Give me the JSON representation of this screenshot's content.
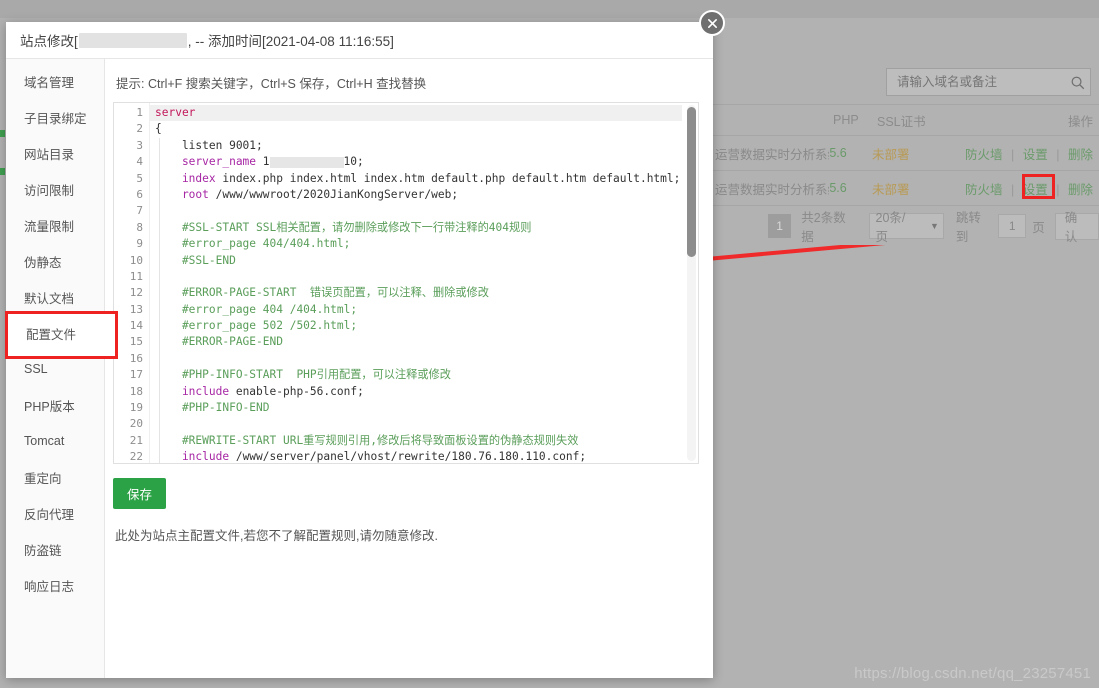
{
  "background": {
    "search": {
      "placeholder": "请输入域名或备注",
      "icon": "search-icon"
    },
    "table": {
      "headers": {
        "php": "PHP",
        "ssl": "SSL证书",
        "ops": "操作"
      },
      "rows": [
        {
          "name": "运营数据实时分析系统",
          "php": "5.6",
          "ssl": "未部署",
          "op_firewall": "防火墙",
          "op_settings": "设置",
          "op_delete": "删除"
        },
        {
          "name": "运营数据实时分析系统",
          "php": "5.6",
          "ssl": "未部署",
          "op_firewall": "防火墙",
          "op_settings": "设置",
          "op_delete": "删除"
        }
      ]
    },
    "pager": {
      "current_page": "1",
      "total_text": "共2条数据",
      "page_size": "20条/页",
      "jump_label": "跳转到",
      "jump_value": "1",
      "page_unit": "页",
      "confirm": "确认"
    }
  },
  "dialog": {
    "title_prefix": "站点修改[",
    "title_suffix": ", -- 添加时间[2021-04-08 11:16:55]",
    "close_icon": "close-icon",
    "sidebar": [
      {
        "label": "域名管理",
        "active": false
      },
      {
        "label": "子目录绑定",
        "active": false
      },
      {
        "label": "网站目录",
        "active": false
      },
      {
        "label": "访问限制",
        "active": false
      },
      {
        "label": "流量限制",
        "active": false
      },
      {
        "label": "伪静态",
        "active": false
      },
      {
        "label": "默认文档",
        "active": false
      },
      {
        "label": "配置文件",
        "active": true
      },
      {
        "label": "SSL",
        "active": false
      },
      {
        "label": "PHP版本",
        "active": false
      },
      {
        "label": "Tomcat",
        "active": false
      },
      {
        "label": "重定向",
        "active": false
      },
      {
        "label": "反向代理",
        "active": false
      },
      {
        "label": "防盗链",
        "active": false
      },
      {
        "label": "响应日志",
        "active": false
      }
    ],
    "hint": "提示: Ctrl+F 搜索关键字，Ctrl+S 保存，Ctrl+H 查找替换",
    "editor": {
      "lines": [
        {
          "n": "1",
          "text": "server"
        },
        {
          "n": "2",
          "text": "{"
        },
        {
          "n": "3",
          "text": "    listen 9001;"
        },
        {
          "n": "4",
          "text": "    server_name 1          10;"
        },
        {
          "n": "5",
          "text": "    index index.php index.html index.htm default.php default.htm default.html;"
        },
        {
          "n": "6",
          "text": "    root /www/wwwroot/2020JianKongServer/web;"
        },
        {
          "n": "7",
          "text": ""
        },
        {
          "n": "8",
          "text": "    #SSL-START SSL相关配置，请勿删除或修改下一行带注释的404规则"
        },
        {
          "n": "9",
          "text": "    #error_page 404/404.html;"
        },
        {
          "n": "10",
          "text": "    #SSL-END"
        },
        {
          "n": "11",
          "text": ""
        },
        {
          "n": "12",
          "text": "    #ERROR-PAGE-START  错误页配置，可以注释、删除或修改"
        },
        {
          "n": "13",
          "text": "    #error_page 404 /404.html;"
        },
        {
          "n": "14",
          "text": "    #error_page 502 /502.html;"
        },
        {
          "n": "15",
          "text": "    #ERROR-PAGE-END"
        },
        {
          "n": "16",
          "text": ""
        },
        {
          "n": "17",
          "text": "    #PHP-INFO-START  PHP引用配置，可以注释或修改"
        },
        {
          "n": "18",
          "text": "    include enable-php-56.conf;"
        },
        {
          "n": "19",
          "text": "    #PHP-INFO-END"
        },
        {
          "n": "20",
          "text": ""
        },
        {
          "n": "21",
          "text": "    #REWRITE-START URL重写规则引用,修改后将导致面板设置的伪静态规则失效"
        },
        {
          "n": "22",
          "text": "    include /www/server/panel/vhost/rewrite/180.76.180.110.conf;"
        }
      ]
    },
    "save_label": "保存",
    "footer_note": "此处为站点主配置文件,若您不了解配置规则,请勿随意修改."
  },
  "watermark": "https://blog.csdn.net/qq_23257451",
  "colors": {
    "accent_green": "#2ba245",
    "annotation_red": "#ef2222",
    "link_green": "#6b9b6b",
    "warn_orange": "#b89a55"
  }
}
